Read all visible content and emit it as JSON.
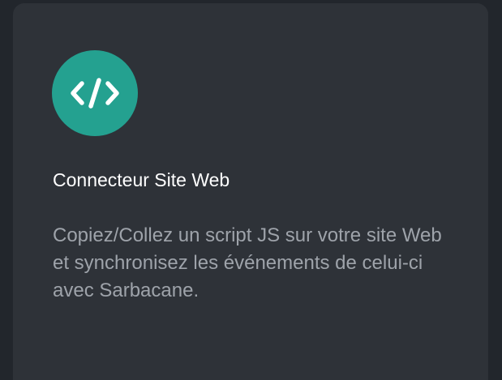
{
  "card": {
    "icon": "code-icon",
    "title": "Connecteur Site Web",
    "description": "Copiez/Collez un script JS sur votre site Web et synchronisez les événements de celui-ci avec Sarbacane."
  },
  "colors": {
    "page_background": "#22262c",
    "card_background": "#2e3238",
    "accent": "#24a190",
    "title": "#ffffff",
    "description": "#9ea3aa"
  }
}
